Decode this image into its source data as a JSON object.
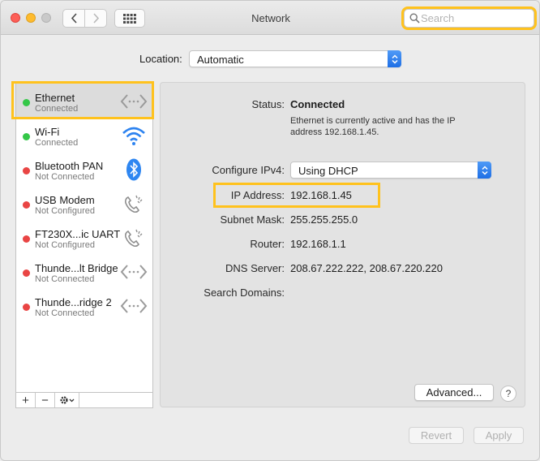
{
  "window": {
    "title": "Network"
  },
  "search": {
    "placeholder": "Search"
  },
  "location": {
    "label": "Location:",
    "value": "Automatic"
  },
  "services": [
    {
      "name": "Ethernet",
      "status": "Connected",
      "status_color": "#34c748",
      "icon": "ethernet-icon"
    },
    {
      "name": "Wi-Fi",
      "status": "Connected",
      "status_color": "#34c748",
      "icon": "wifi-icon"
    },
    {
      "name": "Bluetooth PAN",
      "status": "Not Connected",
      "status_color": "#e94544",
      "icon": "bluetooth-icon"
    },
    {
      "name": "USB Modem",
      "status": "Not Configured",
      "status_color": "#e94544",
      "icon": "phone-icon"
    },
    {
      "name": "FT230X...ic UART",
      "status": "Not Configured",
      "status_color": "#e94544",
      "icon": "phone-icon"
    },
    {
      "name": "Thunde...lt Bridge",
      "status": "Not Connected",
      "status_color": "#e94544",
      "icon": "ethernet-icon"
    },
    {
      "name": "Thunde...ridge 2",
      "status": "Not Connected",
      "status_color": "#e94544",
      "icon": "ethernet-icon"
    }
  ],
  "sidebar_controls": {
    "add": "+",
    "remove": "−"
  },
  "detail": {
    "status_label": "Status:",
    "status_value": "Connected",
    "status_description": "Ethernet is currently active and has the IP address 192.168.1.45.",
    "configure_label": "Configure IPv4:",
    "configure_value": "Using DHCP",
    "ip_label": "IP Address:",
    "ip_value": "192.168.1.45",
    "subnet_label": "Subnet Mask:",
    "subnet_value": "255.255.255.0",
    "router_label": "Router:",
    "router_value": "192.168.1.1",
    "dns_label": "DNS Server:",
    "dns_value": "208.67.222.222, 208.67.220.220",
    "search_domains_label": "Search Domains:",
    "search_domains_value": ""
  },
  "buttons": {
    "advanced": "Advanced...",
    "help": "?",
    "revert": "Revert",
    "apply": "Apply"
  },
  "colors": {
    "highlight": "#ffc21d",
    "accent": "#1e6fe5",
    "connected": "#34c748",
    "disconnected": "#e94544"
  }
}
